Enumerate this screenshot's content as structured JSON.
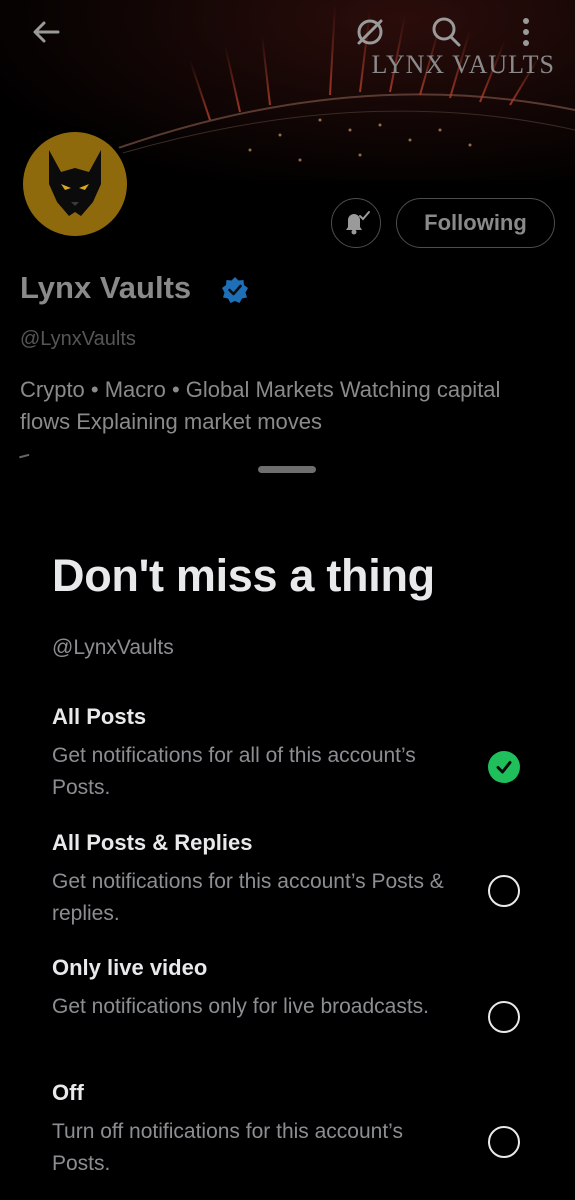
{
  "profile": {
    "banner_text": "LYNX VAULTS",
    "name": "Lynx Vaults",
    "handle": "@LynxVaults",
    "bio": "Crypto • Macro • Global Markets Watching capital flows Explaining market moves",
    "following_label": "Following",
    "verified": true
  },
  "icons": {
    "back": "arrow-left-icon",
    "sync": "no-sync-icon",
    "search": "search-icon",
    "more": "more-vertical-icon",
    "bell": "bell-check-icon",
    "verified": "verified-badge-icon"
  },
  "sheet": {
    "title": "Don't miss a thing",
    "handle": "@LynxVaults",
    "options": [
      {
        "label": "All Posts",
        "description": "Get notifications for all of this account’s Posts.",
        "selected": true
      },
      {
        "label": "All Posts & Replies",
        "description": "Get notifications for this account’s Posts & replies.",
        "selected": false
      },
      {
        "label": "Only live video",
        "description": "Get notifications only for live broadcasts.",
        "selected": false
      },
      {
        "label": "Off",
        "description": "Turn off notifications for this account’s Posts.",
        "selected": false
      }
    ]
  },
  "colors": {
    "background": "#000000",
    "text_primary": "#e7e9ea",
    "text_secondary": "#8b8e92",
    "selected_green": "#1fbf5c",
    "verified_blue": "#1d6fb8",
    "avatar_gold": "#8f6a0c"
  }
}
